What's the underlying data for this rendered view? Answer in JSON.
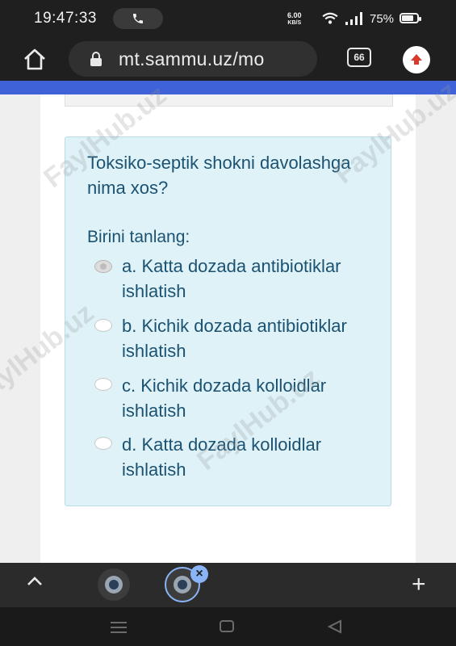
{
  "status_bar": {
    "time": "19:47:33",
    "net_speed_value": "6.00",
    "net_speed_unit": "KB/S",
    "battery_percent": "75%"
  },
  "browser": {
    "url": "mt.sammu.uz/mo",
    "tab_count": "66"
  },
  "quiz": {
    "question": "Toksiko-septik shokni davolashga nima xos?",
    "prompt": "Birini tanlang:",
    "options": [
      {
        "letter": "a.",
        "text": "a. Katta dozada antibiotiklar ishlatish",
        "selected": true
      },
      {
        "letter": "b.",
        "text": "b. Kichik dozada antibiotiklar ishlatish",
        "selected": false
      },
      {
        "letter": "c.",
        "text": "c. Kichik dozada kolloidlar ishlatish",
        "selected": false
      },
      {
        "letter": "d.",
        "text": "d. Katta dozada kolloidlar ishlatish",
        "selected": false
      }
    ]
  },
  "watermark": {
    "text": "FaylHub.uz"
  },
  "colors": {
    "accent_bar": "#3f62d8",
    "question_bg": "#def2f8",
    "question_text": "#1c5271",
    "chrome_dark": "#1f1f1f"
  },
  "icons": [
    "phone-icon",
    "wifi-icon",
    "signal-icon",
    "battery-icon",
    "home-icon",
    "lock-icon",
    "tabs-icon",
    "upload-icon",
    "chevron-up-icon",
    "plus-icon",
    "close-icon",
    "menu-icon",
    "nav-home-icon",
    "back-icon"
  ]
}
